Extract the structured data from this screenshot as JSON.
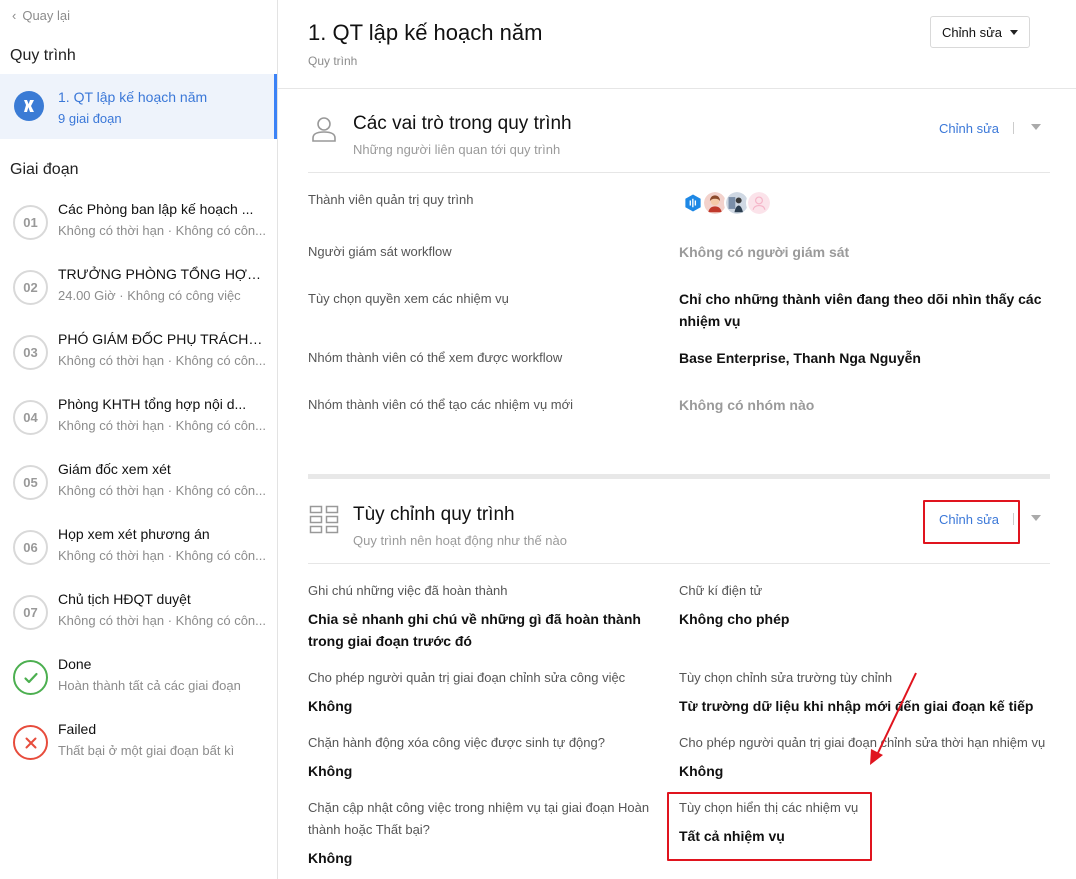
{
  "sidebar": {
    "back_label": "Quay lại",
    "process_heading": "Quy trình",
    "process": {
      "title": "1. QT lập kế hoạch năm",
      "subtitle": "9 giai đoạn"
    },
    "stages_heading": "Giai đoạn",
    "stages": [
      {
        "num": "01",
        "title": "Các Phòng ban lập kế hoạch ...",
        "sub": "Không có thời hạn · Không có côn..."
      },
      {
        "num": "02",
        "title": "TRƯỞNG PHÒNG TỔNG HỢP...",
        "sub": "24.00 Giờ · Không có công việc"
      },
      {
        "num": "03",
        "title": "PHÓ GIÁM ĐỐC PHỤ TRÁCH ...",
        "sub": "Không có thời hạn · Không có côn..."
      },
      {
        "num": "04",
        "title": "Phòng KHTH tổng hợp nội d...",
        "sub": "Không có thời hạn · Không có côn..."
      },
      {
        "num": "05",
        "title": "Giám đốc xem xét",
        "sub": "Không có thời hạn · Không có côn..."
      },
      {
        "num": "06",
        "title": "Họp xem xét phương án",
        "sub": "Không có thời hạn · Không có côn..."
      },
      {
        "num": "07",
        "title": "Chủ tịch HĐQT duyệt",
        "sub": "Không có thời hạn · Không có côn..."
      },
      {
        "title": "Done",
        "sub": "Hoàn thành tất cả các giai đoạn"
      },
      {
        "title": "Failed",
        "sub": "Thất bại ở một giai đoạn bất kì"
      }
    ]
  },
  "header": {
    "title": "1. QT lập kế hoạch năm",
    "subtitle": "Quy trình",
    "edit_label": "Chỉnh sửa"
  },
  "roles": {
    "title": "Các vai trò trong quy trình",
    "subtitle": "Những người liên quan tới quy trình",
    "edit_label": "Chỉnh sửa",
    "rows": [
      {
        "label": "Thành viên quản trị quy trình",
        "value": ""
      },
      {
        "label": "Người giám sát workflow",
        "value": "Không có người giám sát"
      },
      {
        "label": "Tùy chọn quyền xem các nhiệm vụ",
        "value": "Chỉ cho những thành viên đang theo dõi nhìn thấy các nhiệm vụ"
      },
      {
        "label": "Nhóm thành viên có thể xem được workflow",
        "value": "Base Enterprise, Thanh Nga Nguyễn"
      },
      {
        "label": "Nhóm thành viên có thể tạo các nhiệm vụ mới",
        "value": "Không có nhóm nào"
      }
    ]
  },
  "custom": {
    "title": "Tùy chỉnh quy trình",
    "subtitle": "Quy trình nên hoạt động như thế nào",
    "edit_label": "Chỉnh sửa",
    "items": [
      {
        "label": "Ghi chú những việc đã hoàn thành",
        "value": "Chia sẻ nhanh ghi chú về những gì đã hoàn thành trong giai đoạn trước đó"
      },
      {
        "label": "Chữ kí điện tử",
        "value": "Không cho phép"
      },
      {
        "label": "Cho phép người quản trị giai đoạn chỉnh sửa công việc",
        "value": "Không"
      },
      {
        "label": "Tùy chọn chỉnh sửa trường tùy chỉnh",
        "value": "Từ trường dữ liệu khi nhập mới đến giai đoạn kế tiếp"
      },
      {
        "label": "Chặn hành động xóa công việc được sinh tự động?",
        "value": "Không"
      },
      {
        "label": "Cho phép người quản trị giai đoạn chỉnh sửa thời hạn nhiệm vụ",
        "value": "Không"
      },
      {
        "label": "Chặn cập nhật công việc trong nhiệm vụ tại giai đoạn Hoàn thành hoặc Thất bại?",
        "value": "Không"
      },
      {
        "label": "Tùy chọn hiển thị các nhiệm vụ",
        "value": "Tất cả nhiệm vụ"
      }
    ]
  },
  "colors": {
    "accent": "#3b78d8",
    "annotation": "#e0141e",
    "done": "#4caf50",
    "failed": "#e74c3c"
  }
}
